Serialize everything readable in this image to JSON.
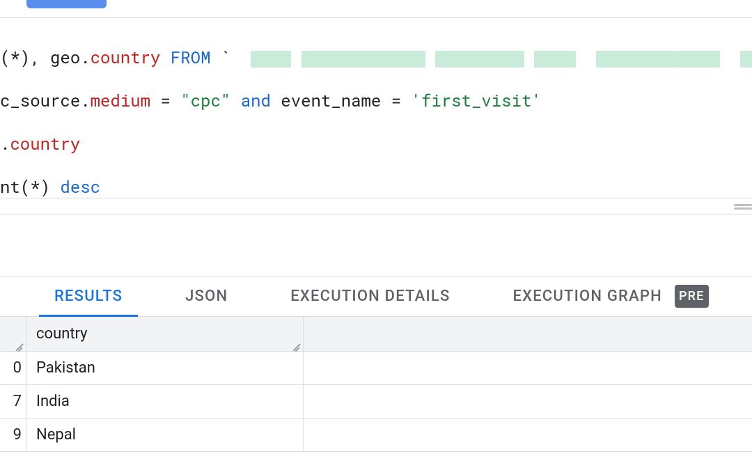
{
  "sql": {
    "line1": {
      "segments": [
        {
          "text": "(*), geo.",
          "cls": "ident"
        },
        {
          "text": "country",
          "cls": "field"
        },
        {
          "text": " ",
          "cls": "ident"
        },
        {
          "text": "FROM",
          "cls": "kw"
        },
        {
          "text": " ",
          "cls": "ident"
        },
        {
          "text": "`",
          "cls": "ident"
        }
      ]
    },
    "line2": {
      "segments": [
        {
          "text": "c_source.",
          "cls": "ident"
        },
        {
          "text": "medium",
          "cls": "field"
        },
        {
          "text": " = ",
          "cls": "op"
        },
        {
          "text": "\"cpc\"",
          "cls": "str"
        },
        {
          "text": " ",
          "cls": "ident"
        },
        {
          "text": "and",
          "cls": "kw"
        },
        {
          "text": " event_name = ",
          "cls": "ident"
        },
        {
          "text": "'first_visit'",
          "cls": "str"
        }
      ]
    },
    "line3": {
      "segments": [
        {
          "text": ".",
          "cls": "ident"
        },
        {
          "text": "country",
          "cls": "field"
        }
      ]
    },
    "line4": {
      "segments": [
        {
          "text": "nt",
          "cls": "ident"
        },
        {
          "text": "(*) ",
          "cls": "ident"
        },
        {
          "text": "desc",
          "cls": "kw"
        }
      ]
    }
  },
  "tabs": {
    "results": "RESULTS",
    "json": "JSON",
    "exec_details": "EXECUTION DETAILS",
    "exec_graph": "EXECUTION GRAPH",
    "preview_badge": "PRE"
  },
  "table": {
    "header_country": "country",
    "rows": [
      {
        "num": "0",
        "country": "Pakistan"
      },
      {
        "num": "7",
        "country": "India"
      },
      {
        "num": "9",
        "country": "Nepal"
      }
    ]
  }
}
